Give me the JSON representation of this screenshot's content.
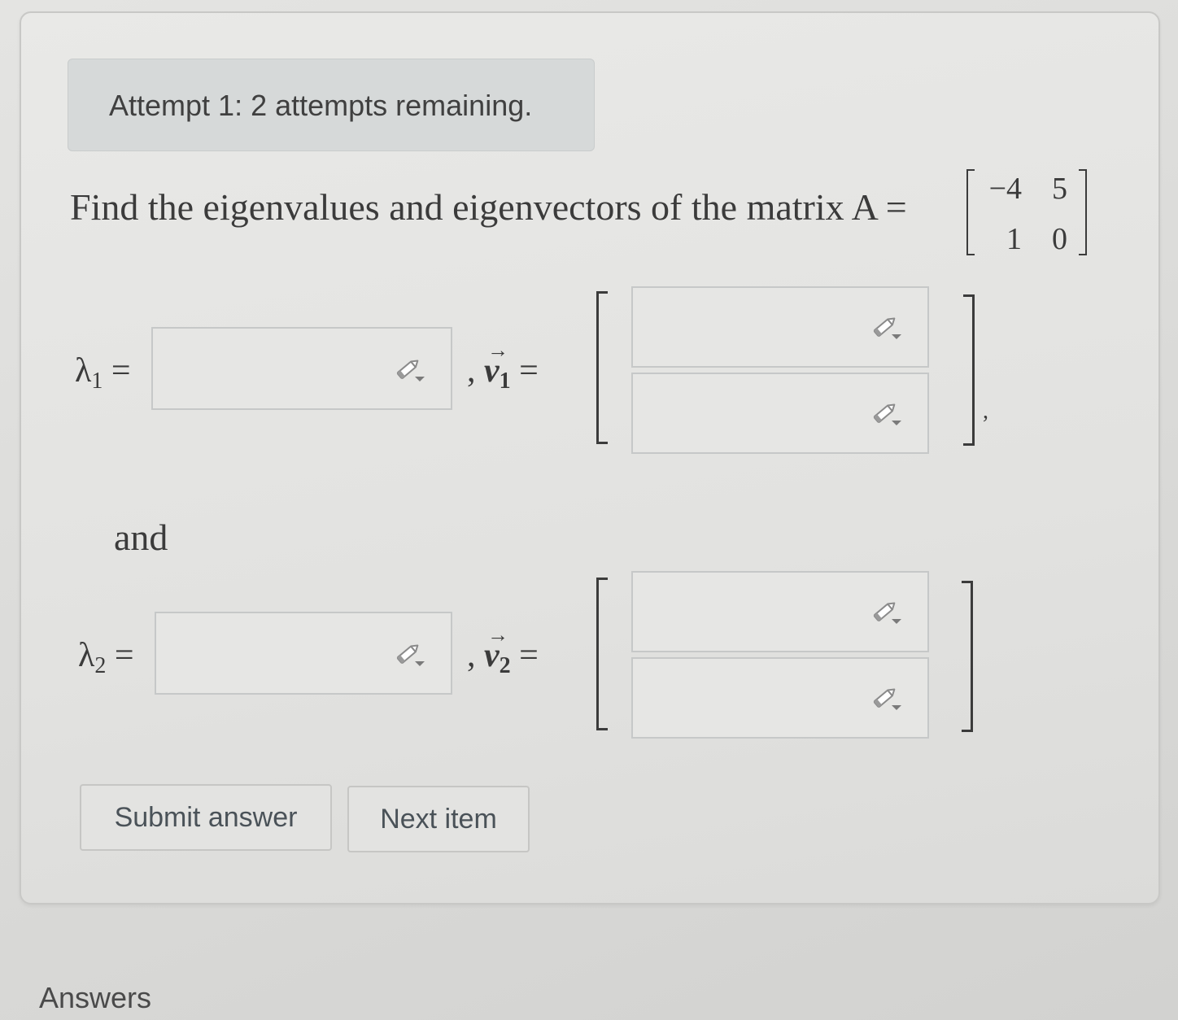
{
  "attempt_banner": "Attempt 1: 2 attempts remaining.",
  "question": {
    "text": "Find the eigenvalues and eigenvectors of the matrix A =",
    "matrix": [
      [
        "−4",
        "5"
      ],
      [
        "1",
        "0"
      ]
    ]
  },
  "rows": [
    {
      "lambda_symbol": "λ",
      "lambda_sub": "1",
      "lambda_eq": "=",
      "sep": ",",
      "vec_symbol": "v",
      "vec_sub": "1",
      "vec_eq": "=",
      "trailing": ","
    },
    {
      "lambda_symbol": "λ",
      "lambda_sub": "2",
      "lambda_eq": "=",
      "sep": ",",
      "vec_symbol": "v",
      "vec_sub": "2",
      "vec_eq": "="
    }
  ],
  "connector": "and",
  "buttons": {
    "submit": "Submit answer",
    "next": "Next item"
  },
  "answers_heading": "Answers",
  "icons": {
    "input_tool": "pencil-dropdown-icon"
  },
  "colors": {
    "background": "#e0e0de",
    "banner": "#d6d9d9",
    "text": "#3b3b3b",
    "button_text": "#4a5258"
  }
}
